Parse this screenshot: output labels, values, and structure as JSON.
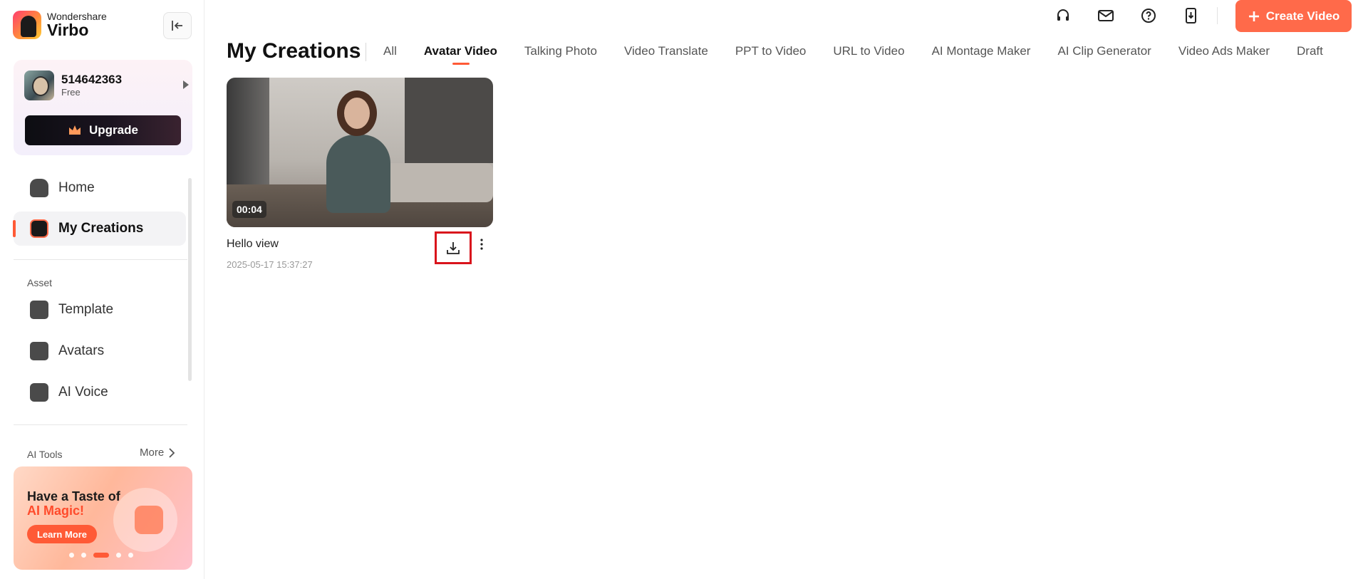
{
  "brand": {
    "sub": "Wondershare",
    "name": "Virbo"
  },
  "user": {
    "id": "514642363",
    "plan": "Free",
    "upgrade_label": "Upgrade"
  },
  "nav": {
    "home": "Home",
    "my_creations": "My Creations",
    "asset_label": "Asset",
    "template": "Template",
    "avatars": "Avatars",
    "ai_voice": "AI Voice",
    "ai_tools_label": "AI Tools",
    "more_label": "More"
  },
  "promo": {
    "line1": "Have a Taste of",
    "line2": "AI Magic!",
    "button": "Learn More"
  },
  "header": {
    "create_label": "Create Video",
    "icons": [
      "headset-icon",
      "mail-icon",
      "help-icon",
      "phone-download-icon"
    ]
  },
  "main": {
    "title": "My Creations",
    "tabs": [
      {
        "label": "All",
        "active": false
      },
      {
        "label": "Avatar Video",
        "active": true
      },
      {
        "label": "Talking Photo",
        "active": false
      },
      {
        "label": "Video Translate",
        "active": false
      },
      {
        "label": "PPT to Video",
        "active": false
      },
      {
        "label": "URL to Video",
        "active": false
      },
      {
        "label": "AI Montage Maker",
        "active": false
      },
      {
        "label": "AI Clip Generator",
        "active": false
      },
      {
        "label": "Video Ads Maker",
        "active": false
      },
      {
        "label": "Draft",
        "active": false
      }
    ]
  },
  "videos": [
    {
      "title": "Hello view",
      "date": "2025-05-17 15:37:27",
      "duration": "00:04"
    }
  ],
  "colors": {
    "accent": "#ff6a4a",
    "highlight": "#d9141c"
  }
}
